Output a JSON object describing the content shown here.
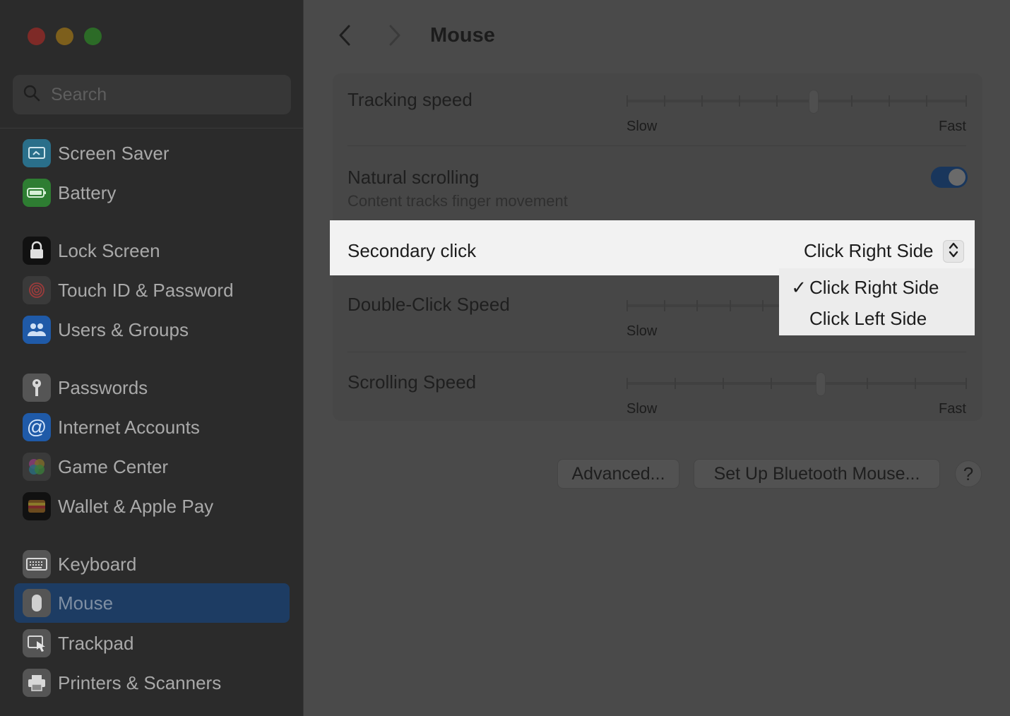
{
  "window": {
    "title": "Mouse"
  },
  "search": {
    "placeholder": "Search"
  },
  "sidebar": {
    "items": [
      {
        "label": "Screen Saver",
        "icon": "screen-saver-icon",
        "color": "#2a6f8a"
      },
      {
        "label": "Battery",
        "icon": "battery-icon",
        "color": "#2e7d32"
      },
      {
        "label": "Lock Screen",
        "icon": "lock-icon",
        "color": "#111111"
      },
      {
        "label": "Touch ID & Password",
        "icon": "fingerprint-icon",
        "color": "#3a3a3a"
      },
      {
        "label": "Users & Groups",
        "icon": "users-icon",
        "color": "#1f5aa8"
      },
      {
        "label": "Passwords",
        "icon": "key-icon",
        "color": "#555555"
      },
      {
        "label": "Internet Accounts",
        "icon": "at-icon",
        "color": "#1f5aa8"
      },
      {
        "label": "Game Center",
        "icon": "game-center-icon",
        "color": "#3a3a3a"
      },
      {
        "label": "Wallet & Apple Pay",
        "icon": "wallet-icon",
        "color": "#111111"
      },
      {
        "label": "Keyboard",
        "icon": "keyboard-icon",
        "color": "#555555"
      },
      {
        "label": "Mouse",
        "icon": "mouse-icon",
        "color": "#555555",
        "selected": true
      },
      {
        "label": "Trackpad",
        "icon": "trackpad-icon",
        "color": "#555555"
      },
      {
        "label": "Printers & Scanners",
        "icon": "printer-icon",
        "color": "#555555"
      }
    ]
  },
  "settings": {
    "tracking": {
      "label": "Tracking speed",
      "min_label": "Slow",
      "max_label": "Fast",
      "value": 0.55
    },
    "natural": {
      "label": "Natural scrolling",
      "sublabel": "Content tracks finger movement",
      "enabled": true
    },
    "secondary": {
      "label": "Secondary click",
      "value": "Click Right Side"
    },
    "double_click": {
      "label": "Double-Click Speed",
      "min_label": "Slow"
    },
    "scrolling": {
      "label": "Scrolling Speed",
      "min_label": "Slow",
      "max_label": "Fast",
      "value": 0.57
    }
  },
  "menu": {
    "options": [
      {
        "label": "Click Right Side",
        "checked": true,
        "check": "✓"
      },
      {
        "label": "Click Left Side",
        "checked": false,
        "check": ""
      }
    ]
  },
  "buttons": {
    "advanced": "Advanced...",
    "bluetooth": "Set Up Bluetooth Mouse...",
    "help": "?"
  }
}
